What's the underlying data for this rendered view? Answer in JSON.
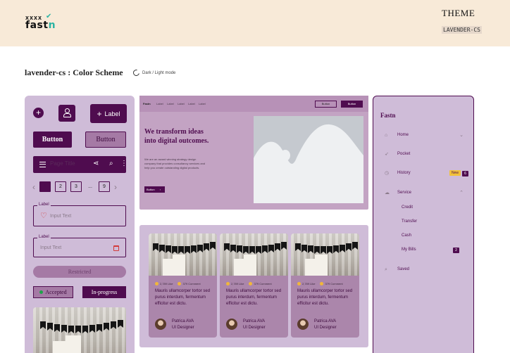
{
  "header": {
    "logo_marks": "xxxx",
    "logo_text": "fast",
    "logo_text_accent": "n",
    "theme_title": "THEME",
    "theme_name": "LAVENDER-CS"
  },
  "scheme": {
    "title": "lavender-cs : Color Scheme",
    "mode_toggle_label": "Dark / Light mode"
  },
  "components": {
    "add_icon": "plus-icon",
    "user_icon": "person-icon",
    "label_button": "Label",
    "button_primary": "Button",
    "button_secondary": "Button",
    "toolbar_title": "Page Title",
    "pagination": {
      "pages": [
        "1",
        "2",
        "3",
        "...",
        "9"
      ],
      "active_page": "1"
    },
    "input_label_1": "Label",
    "input_placeholder_1": "Input Text",
    "input_label_2": "Label",
    "input_placeholder_2": "Input Text",
    "restricted": "Restricted",
    "chip_accepted": "Accepted",
    "chip_progress": "In-progress"
  },
  "hero": {
    "nav_brand": "Fastn",
    "nav_links": [
      "Label",
      "Label",
      "Label",
      "Label",
      "Label"
    ],
    "nav_button_1": "Button",
    "nav_button_2": "Button",
    "heading": "We transform ideas into digital outcomes.",
    "description": "We are an award winning strategy design company that provides consultancy services and help you create outstanding digital products.",
    "cta": "Button"
  },
  "cards": [
    {
      "likes": "2,789 Like",
      "comments": "379 Comment",
      "text": "Mauris ullamcorper tortor sed purus interdum, fermentum efficitur est dictu.",
      "name": "Patrica AVA",
      "role": "UI Designer"
    },
    {
      "likes": "2,789 Like",
      "comments": "379 Comment",
      "text": "Mauris ullamcorper tortor sed purus interdum, fermentum efficitur est dictu.",
      "name": "Patrica AVA",
      "role": "UI Designer"
    },
    {
      "likes": "2,789 Like",
      "comments": "379 Comment",
      "text": "Mauris ullamcorper tortor sed purus interdum, fermentum efficitur est dictu.",
      "name": "Patrica AVA",
      "role": "UI Designer"
    }
  ],
  "sidebar": {
    "title": "Fastn",
    "items": [
      {
        "label": "Home",
        "icon": "home-icon"
      },
      {
        "label": "Pocket",
        "icon": "rocket-icon"
      },
      {
        "label": "History",
        "icon": "clock-icon",
        "badge": "New",
        "count": "6"
      },
      {
        "label": "Service",
        "icon": "cloud-icon"
      },
      {
        "label": "Saved",
        "icon": "search-icon"
      }
    ],
    "sub_items": [
      {
        "label": "Credit"
      },
      {
        "label": "Transfer"
      },
      {
        "label": "Cash"
      },
      {
        "label": "My Bills",
        "count": "2"
      }
    ]
  },
  "colors": {
    "primary": "#4f0c4f",
    "surface": "#cfbcd8",
    "hero_background": "#c3a3c3",
    "card_background": "#ab86ab",
    "header_background": "#f8ead8",
    "badge_yellow": "#f2c23b",
    "accent_teal": "#2bb3a3"
  }
}
